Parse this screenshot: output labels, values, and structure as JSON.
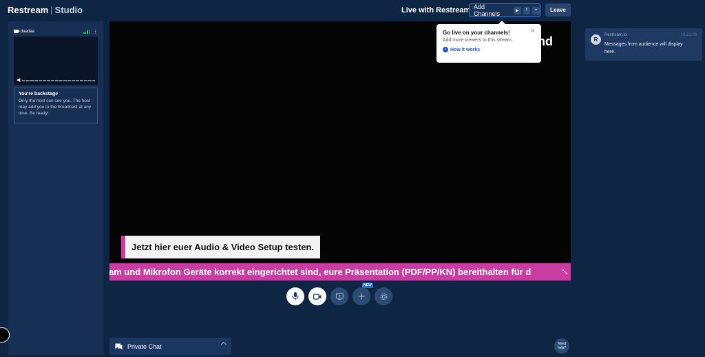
{
  "app": {
    "brand": "Restream",
    "product": "Studio"
  },
  "header": {
    "live_title": "Live with Restream",
    "add_channels_label": "Add Channels",
    "leave_label": "Leave"
  },
  "participant": {
    "name": "daadaa"
  },
  "backstage": {
    "title": "You're backstage",
    "description": "Only the host can see you. The host may add you to the broadcast at any time. Be ready!"
  },
  "stage": {
    "partial_text": "nd",
    "lower_third": "Jetzt hier euer Audio & Video Setup testen.",
    "ticker": "am und Mikrofon Geräte korrekt eingerichtet sind, eure Präsentation (PDF/PP/KN) bereithalten für d"
  },
  "popover": {
    "title": "Go live on your channels!",
    "subtitle": "Add more viewers to this stream.",
    "link": "How it works"
  },
  "controls": {
    "new_badge": "NEW"
  },
  "private_chat": {
    "label": "Private Chat"
  },
  "need_help": {
    "label": "Need help?"
  },
  "chat": {
    "messages": [
      {
        "from": "Restream.io",
        "time": "16:21:03",
        "text": "Messages from audience will display here."
      }
    ]
  },
  "colors": {
    "background": "#0f2544",
    "panel": "#162f52",
    "accent_pink": "#c93da3",
    "accent_blue": "#1f6fe5",
    "signal_green": "#35c25e"
  }
}
